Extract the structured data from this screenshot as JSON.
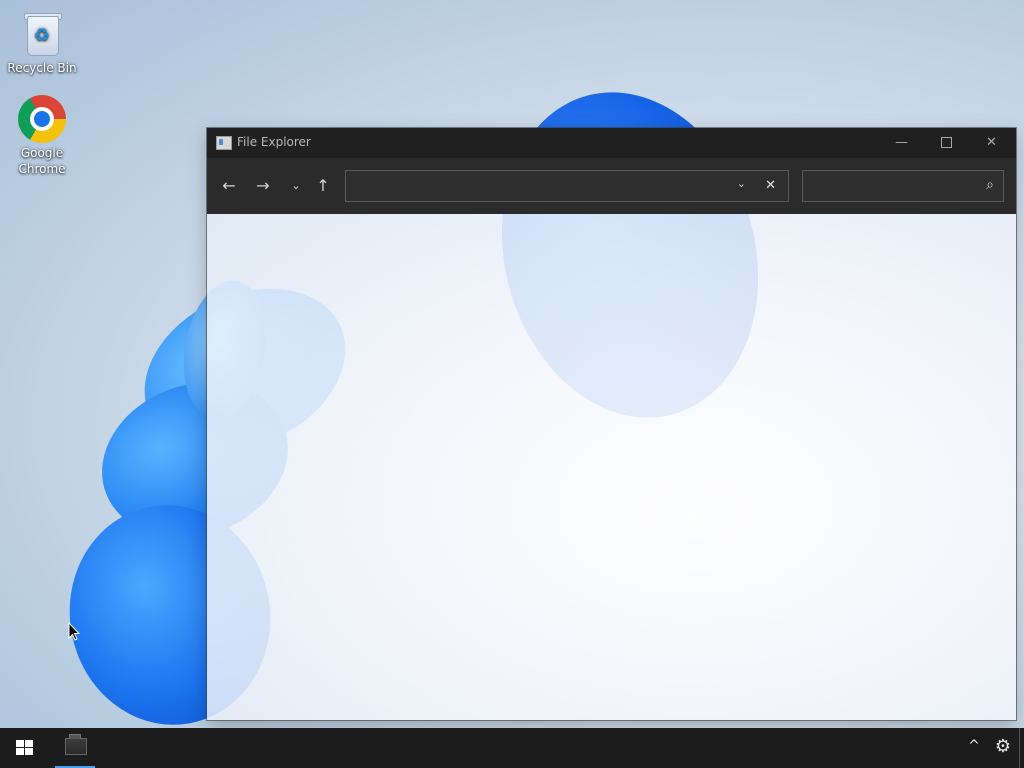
{
  "desktop": {
    "icons": [
      {
        "label": "Recycle Bin",
        "icon": "recycle-bin-icon"
      },
      {
        "label": "Google Chrome",
        "icon": "chrome-icon"
      }
    ]
  },
  "window": {
    "title": "File Explorer",
    "icon": "file-explorer-icon",
    "controls": {
      "minimize": "—",
      "maximize": "□",
      "close": "✕"
    },
    "toolbar": {
      "back": "←",
      "forward": "→",
      "recent": "⌄",
      "up": "↑",
      "address_value": "",
      "address_dropdown": "⌄",
      "address_clear": "✕",
      "search_value": "",
      "search_icon": "⌕"
    }
  },
  "taskbar": {
    "start_icon": "windows-logo-icon",
    "apps": [
      {
        "name": "File Explorer",
        "active": true
      }
    ],
    "tray": {
      "show_hidden": "^",
      "settings": "⚙"
    }
  },
  "colors": {
    "titlebar": "#202020",
    "toolbar": "#2b2b2b",
    "taskbar": "#1c1c1c",
    "accent": "#4aa3f0"
  }
}
